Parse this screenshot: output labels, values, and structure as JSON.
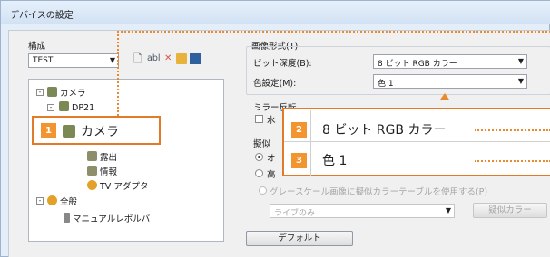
{
  "window": {
    "title": "デバイスの設定"
  },
  "left": {
    "section_label": "構成",
    "config_combo": {
      "value": "TEST"
    },
    "toolbar": {
      "new_icon": "new-document-icon",
      "rename_label": "abl",
      "delete_icon": "delete-icon",
      "open_icon": "open-folder-icon",
      "save_icon": "save-icon"
    },
    "tree": {
      "root": "カメラ",
      "dp21": "DP21",
      "camera": "カメラ",
      "exposure": "露出",
      "info": "情報",
      "tv_adapter": "TV アダプタ",
      "general": "全般",
      "revolver": "マニュアルレボルバ"
    }
  },
  "right": {
    "image_format_label": "画像形式(T)",
    "bit_depth_label": "ビット深度(B):",
    "bit_depth_value": "8 ビット RGB カラー",
    "color_setting_label": "色設定(M):",
    "color_setting_value": "色 1",
    "mirror_label": "ミラー反転",
    "mirror_check_label": "水",
    "pseudo_label": "擬似",
    "radio1_label": "オ",
    "radio2_label": "高",
    "grayscale_label": "グレースケール画像に擬似カラーテーブルを使用する(P)",
    "live_combo_value": "ライブのみ",
    "pseudo_button": "疑似カラー",
    "default_button": "デフォルト"
  },
  "callouts": {
    "c1": {
      "number": "1",
      "text": "カメラ"
    },
    "c2": {
      "number": "2",
      "text": "8 ビット RGB カラー"
    },
    "c3": {
      "number": "3",
      "text": "色 1"
    }
  },
  "colors": {
    "accent": "#f29530",
    "dotted": "#e98a2e",
    "window_bg": "#e3eef9"
  }
}
